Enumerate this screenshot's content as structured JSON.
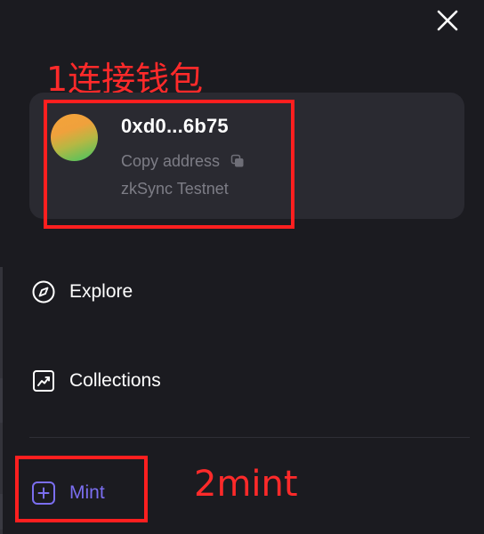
{
  "annotations": {
    "label_1": "1连接钱包",
    "label_2": "2mint",
    "color": "#ff1f1f"
  },
  "wallet": {
    "address": "0xd0...6b75",
    "copy_label": "Copy address",
    "network": "zkSync Testnet",
    "avatar_colors": [
      "#f3a33a",
      "#3fc663"
    ]
  },
  "nav": {
    "items": [
      {
        "label": "Explore",
        "icon": "compass-icon"
      },
      {
        "label": "Collections",
        "icon": "trending-chart-icon"
      },
      {
        "label": "Mint",
        "icon": "plus-square-icon"
      }
    ]
  },
  "colors": {
    "background": "#1b1b20",
    "card": "#2a2a31",
    "accent": "#7b6ef0",
    "muted_text": "#7d7d86"
  },
  "icons": {
    "close": "close-icon",
    "copy": "copy-icon"
  }
}
